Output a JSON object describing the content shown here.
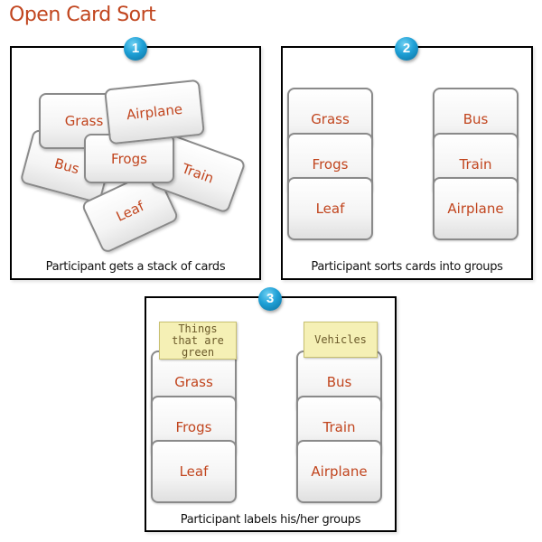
{
  "title": "Open Card Sort",
  "colors": {
    "card_text": "#c1451e",
    "badge": "#1fa0d6",
    "sticky": "#f5f0b5"
  },
  "steps": [
    {
      "number": "1",
      "caption": "Participant gets a stack of cards",
      "cards": [
        "Grass",
        "Airplane",
        "Bus",
        "Frogs",
        "Train",
        "Leaf"
      ]
    },
    {
      "number": "2",
      "caption": "Participant sorts cards into groups",
      "groups": [
        {
          "cards": [
            "Grass",
            "Frogs",
            "Leaf"
          ]
        },
        {
          "cards": [
            "Bus",
            "Train",
            "Airplane"
          ]
        }
      ]
    },
    {
      "number": "3",
      "caption": "Participant labels his/her groups",
      "groups": [
        {
          "label": "Things that are green",
          "cards": [
            "Grass",
            "Frogs",
            "Leaf"
          ]
        },
        {
          "label": "Vehicles",
          "cards": [
            "Bus",
            "Train",
            "Airplane"
          ]
        }
      ]
    }
  ]
}
